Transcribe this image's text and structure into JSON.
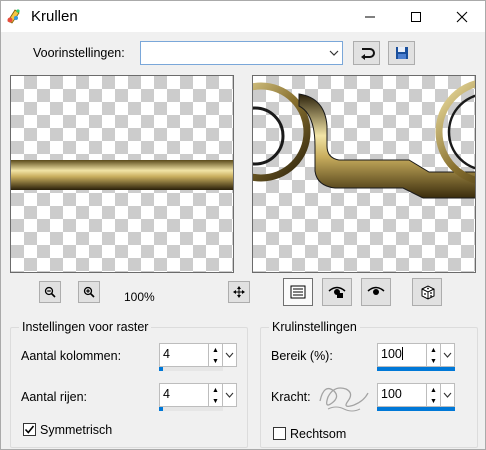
{
  "window": {
    "title": "Krullen",
    "minimize_icon": "minimize-icon",
    "maximize_icon": "maximize-icon",
    "close_icon": "close-icon"
  },
  "presets": {
    "label": "Voorinstellingen:",
    "value": "",
    "reset_icon": "reset-arrow-icon",
    "save_icon": "floppy-save-icon"
  },
  "preview": {
    "zoom_level": "100%",
    "zoom_out_icon": "zoom-out-icon",
    "zoom_in_icon": "zoom-in-icon",
    "move_icon": "move-arrows-icon"
  },
  "view_buttons": [
    "properties-icon",
    "show-original-icon",
    "show-preview-icon",
    "randomize-dice-icon"
  ],
  "raster": {
    "title": "Instellingen voor raster",
    "columns_label": "Aantal kolommen:",
    "columns_value": "4",
    "rows_label": "Aantal rijen:",
    "rows_value": "4",
    "symmetric_label": "Symmetrisch",
    "symmetric_checked": true
  },
  "curls": {
    "title": "Krulinstellingen",
    "range_label": "Bereik (%):",
    "range_value": "100",
    "strength_label": "Kracht:",
    "strength_value": "100",
    "clockwise_label": "Rechtsom",
    "clockwise_checked": false
  },
  "colors": {
    "accent": "#0078d7",
    "gold_light": "#f2e4a6",
    "gold_dark": "#4a3b12"
  }
}
